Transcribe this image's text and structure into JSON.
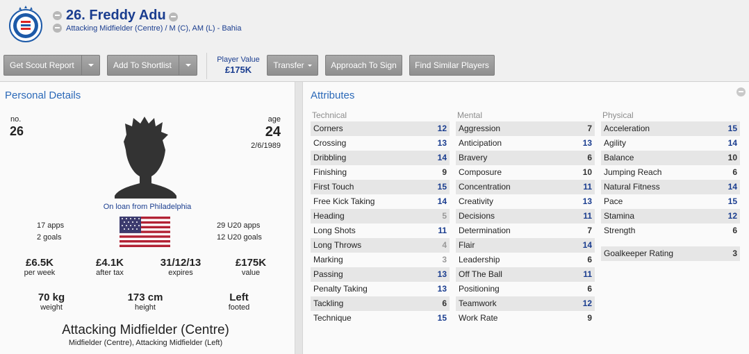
{
  "header": {
    "title": "26. Freddy Adu",
    "subtitle": "Attacking Midfielder (Centre) / M (C), AM (L) - Bahia"
  },
  "toolbar": {
    "scout_report": "Get Scout Report",
    "shortlist": "Add To Shortlist",
    "player_value_label": "Player Value",
    "player_value": "£175K",
    "transfer": "Transfer",
    "approach": "Approach To Sign",
    "similar": "Find Similar Players"
  },
  "personal": {
    "title": "Personal Details",
    "no_label": "no.",
    "no": "26",
    "age_label": "age",
    "age": "24",
    "dob": "2/6/1989",
    "loan": "On loan from Philadelphia",
    "apps": "17 apps",
    "goals": "2 goals",
    "u20_apps": "29 U20 apps",
    "u20_goals": "12 U20 goals",
    "wage": "£6.5K",
    "wage_label": "per week",
    "after_tax": "£4.1K",
    "after_tax_label": "after tax",
    "expires": "31/12/13",
    "expires_label": "expires",
    "value": "£175K",
    "value_label": "value",
    "weight": "70 kg",
    "weight_label": "weight",
    "height": "173 cm",
    "height_label": "height",
    "foot": "Left",
    "foot_label": "footed",
    "position": "Attacking Midfielder (Centre)",
    "positions_other": "Midfielder (Centre), Attacking Midfielder (Left)"
  },
  "attributes": {
    "title": "Attributes",
    "technical": {
      "label": "Technical",
      "items": [
        {
          "name": "Corners",
          "value": "12"
        },
        {
          "name": "Crossing",
          "value": "13"
        },
        {
          "name": "Dribbling",
          "value": "14"
        },
        {
          "name": "Finishing",
          "value": "9"
        },
        {
          "name": "First Touch",
          "value": "15"
        },
        {
          "name": "Free Kick Taking",
          "value": "14"
        },
        {
          "name": "Heading",
          "value": "5"
        },
        {
          "name": "Long Shots",
          "value": "11"
        },
        {
          "name": "Long Throws",
          "value": "4"
        },
        {
          "name": "Marking",
          "value": "3"
        },
        {
          "name": "Passing",
          "value": "13"
        },
        {
          "name": "Penalty Taking",
          "value": "13"
        },
        {
          "name": "Tackling",
          "value": "6"
        },
        {
          "name": "Technique",
          "value": "15"
        }
      ]
    },
    "mental": {
      "label": "Mental",
      "items": [
        {
          "name": "Aggression",
          "value": "7"
        },
        {
          "name": "Anticipation",
          "value": "13"
        },
        {
          "name": "Bravery",
          "value": "6"
        },
        {
          "name": "Composure",
          "value": "10"
        },
        {
          "name": "Concentration",
          "value": "11"
        },
        {
          "name": "Creativity",
          "value": "13"
        },
        {
          "name": "Decisions",
          "value": "11"
        },
        {
          "name": "Determination",
          "value": "7"
        },
        {
          "name": "Flair",
          "value": "14"
        },
        {
          "name": "Leadership",
          "value": "6"
        },
        {
          "name": "Off The Ball",
          "value": "11"
        },
        {
          "name": "Positioning",
          "value": "6"
        },
        {
          "name": "Teamwork",
          "value": "12"
        },
        {
          "name": "Work Rate",
          "value": "9"
        }
      ]
    },
    "physical": {
      "label": "Physical",
      "items": [
        {
          "name": "Acceleration",
          "value": "15"
        },
        {
          "name": "Agility",
          "value": "14"
        },
        {
          "name": "Balance",
          "value": "10"
        },
        {
          "name": "Jumping Reach",
          "value": "6"
        },
        {
          "name": "Natural Fitness",
          "value": "14"
        },
        {
          "name": "Pace",
          "value": "15"
        },
        {
          "name": "Stamina",
          "value": "12"
        },
        {
          "name": "Strength",
          "value": "6"
        }
      ],
      "gk_label": "Goalkeeper Rating",
      "gk_value": "3"
    }
  }
}
